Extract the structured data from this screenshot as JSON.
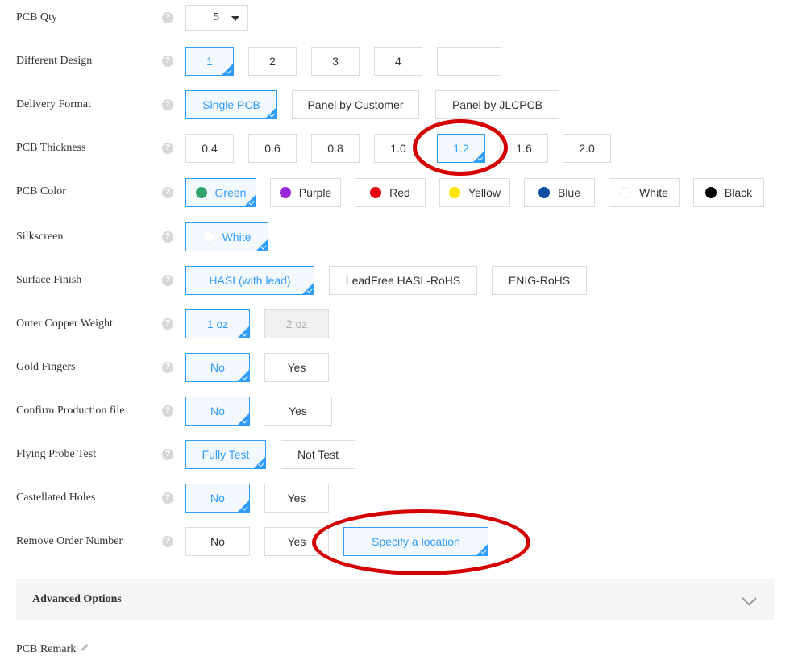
{
  "fields": {
    "pcb_qty": {
      "label": "PCB Qty",
      "value": "5"
    },
    "different_design": {
      "label": "Different Design",
      "options": [
        "1",
        "2",
        "3",
        "4",
        ""
      ],
      "selected": "1"
    },
    "delivery_format": {
      "label": "Delivery Format",
      "options": [
        "Single PCB",
        "Panel by Customer",
        "Panel by JLCPCB"
      ],
      "selected": "Single PCB"
    },
    "pcb_thickness": {
      "label": "PCB Thickness",
      "options": [
        "0.4",
        "0.6",
        "0.8",
        "1.0",
        "1.2",
        "1.6",
        "2.0"
      ],
      "selected": "1.2"
    },
    "pcb_color": {
      "label": "PCB Color",
      "options": [
        {
          "name": "Green",
          "color": "#2fa56b"
        },
        {
          "name": "Purple",
          "color": "#9b27d6"
        },
        {
          "name": "Red",
          "color": "#e60012"
        },
        {
          "name": "Yellow",
          "color": "#ffe600"
        },
        {
          "name": "Blue",
          "color": "#0b4ea2"
        },
        {
          "name": "White",
          "color": "#ffffff"
        },
        {
          "name": "Black",
          "color": "#000000"
        }
      ],
      "selected": "Green"
    },
    "silkscreen": {
      "label": "Silkscreen",
      "options": [
        {
          "name": "White",
          "color": "#ffffff"
        }
      ],
      "selected": "White"
    },
    "surface_finish": {
      "label": "Surface Finish",
      "options": [
        "HASL(with lead)",
        "LeadFree HASL-RoHS",
        "ENIG-RoHS"
      ],
      "selected": "HASL(with lead)"
    },
    "outer_copper_weight": {
      "label": "Outer Copper Weight",
      "options": [
        "1 oz",
        "2 oz"
      ],
      "selected": "1 oz",
      "disabled": [
        "2 oz"
      ]
    },
    "gold_fingers": {
      "label": "Gold Fingers",
      "options": [
        "No",
        "Yes"
      ],
      "selected": "No"
    },
    "confirm_production_file": {
      "label": "Confirm Production file",
      "options": [
        "No",
        "Yes"
      ],
      "selected": "No"
    },
    "flying_probe_test": {
      "label": "Flying Probe Test",
      "options": [
        "Fully Test",
        "Not Test"
      ],
      "selected": "Fully Test"
    },
    "castellated_holes": {
      "label": "Castellated Holes",
      "options": [
        "No",
        "Yes"
      ],
      "selected": "No"
    },
    "remove_order_number": {
      "label": "Remove Order Number",
      "options": [
        "No",
        "Yes",
        "Specify a location"
      ],
      "selected": "Specify a location"
    }
  },
  "help_icon": "question-icon",
  "help_glyph": "?",
  "advanced_options": {
    "label": "Advanced Options",
    "icon": "chevron-down-icon"
  },
  "pcb_remark": {
    "label": "PCB Remark",
    "icon": "pencil-icon"
  },
  "colors": {
    "accent": "#2f9cff",
    "annotation": "#d40000"
  }
}
